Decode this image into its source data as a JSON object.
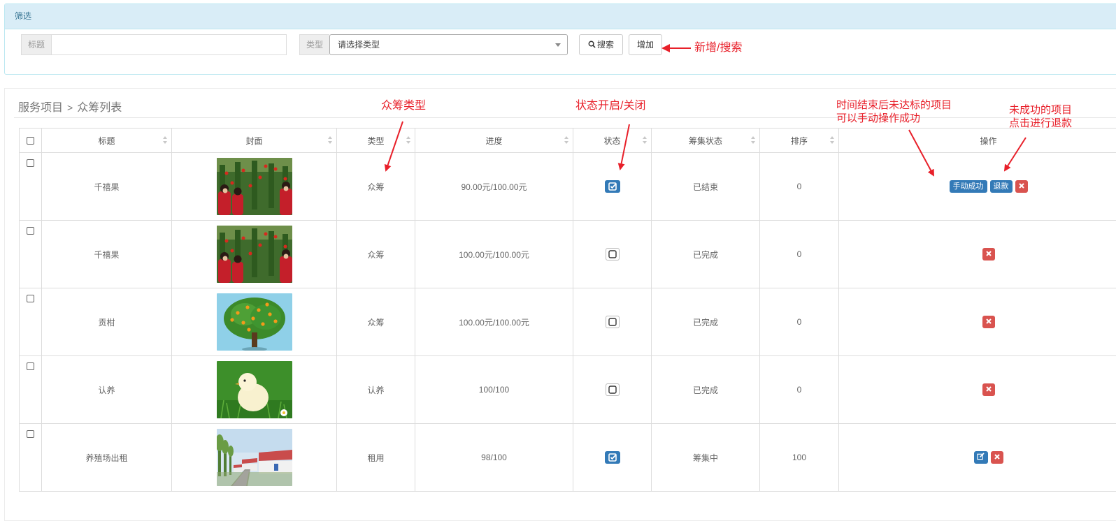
{
  "filter": {
    "heading": "筛选",
    "title_label": "标题",
    "title_value": "",
    "type_label": "类型",
    "type_selected": "请选择类型",
    "search_label": "搜索",
    "add_label": "增加"
  },
  "annotations": {
    "add_search": "新增/搜索",
    "crowdfund_type": "众筹类型",
    "status_toggle": "状态开启/关闭",
    "manual_success_1": "时间结束后未达标的项目",
    "manual_success_2": "可以手动操作成功",
    "refund_1": "未成功的项目",
    "refund_2": "点击进行退款"
  },
  "breadcrumb": {
    "parent": "服务项目",
    "separator": ">",
    "current": "众筹列表"
  },
  "table": {
    "columns": [
      "标题",
      "封面",
      "类型",
      "进度",
      "状态",
      "筹集状态",
      "排序",
      "操作"
    ],
    "rows": [
      {
        "title": "千禧果",
        "cover": "tomato-pickers",
        "type": "众筹",
        "progress": "90.00元/100.00元",
        "status_on": true,
        "raise_status": "已结束",
        "sort": "0",
        "actions": [
          "手动成功",
          "退款",
          "delete"
        ]
      },
      {
        "title": "千禧果",
        "cover": "tomato-pickers",
        "type": "众筹",
        "progress": "100.00元/100.00元",
        "status_on": false,
        "raise_status": "已完成",
        "sort": "0",
        "actions": [
          "delete"
        ]
      },
      {
        "title": "贡柑",
        "cover": "orange-tree",
        "type": "众筹",
        "progress": "100.00元/100.00元",
        "status_on": false,
        "raise_status": "已完成",
        "sort": "0",
        "actions": [
          "delete"
        ]
      },
      {
        "title": "认养",
        "cover": "chick",
        "type": "认养",
        "progress": "100/100",
        "status_on": false,
        "raise_status": "已完成",
        "sort": "0",
        "actions": [
          "delete"
        ]
      },
      {
        "title": "养殖场出租",
        "cover": "farm-buildings",
        "type": "租用",
        "progress": "98/100",
        "status_on": true,
        "raise_status": "筹集中",
        "sort": "100",
        "actions": [
          "edit",
          "delete"
        ]
      }
    ]
  },
  "colors": {
    "primary": "#337ab7",
    "danger": "#d9534f",
    "annotation": "#e8202a",
    "panel_heading": "#d9edf7"
  }
}
